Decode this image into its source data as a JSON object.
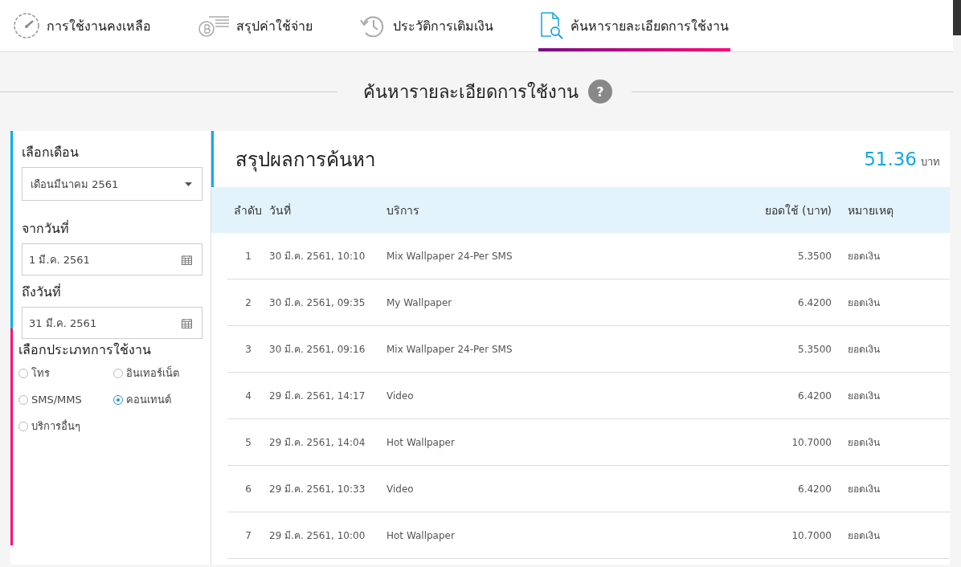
{
  "tabs": [
    {
      "label": "การใช้งานคงเหลือ",
      "kind": "gauge",
      "selected": false
    },
    {
      "label": "สรุปค่าใช้จ่าย",
      "kind": "coin",
      "selected": false
    },
    {
      "label": "ประวัติการเติมเงิน",
      "kind": "history",
      "selected": false
    },
    {
      "label": "ค้นหารายละเอียดการใช้งาน",
      "kind": "search",
      "selected": true
    }
  ],
  "page_title": "ค้นหารายละเอียดการใช้งาน",
  "help_label": "?",
  "filters": {
    "month_label": "เลือกเดือน",
    "month_value": "เดือนมีนาคม 2561",
    "from_label": "จากวันที่",
    "from_value": "1 มี.ค. 2561",
    "to_label": "ถึงวันที่",
    "to_value": "31 มี.ค. 2561",
    "type_label": "เลือกประเภทการใช้งาน",
    "types": [
      {
        "label": "โทร",
        "selected": false
      },
      {
        "label": "อินเทอร์เน็ต",
        "selected": false
      },
      {
        "label": "SMS/MMS",
        "selected": false
      },
      {
        "label": "คอนเทนต์",
        "selected": true
      },
      {
        "label": "บริการอื่นๆ",
        "selected": false
      }
    ]
  },
  "results": {
    "title": "สรุปผลการค้นหา",
    "total": "51.36",
    "currency": "บาท",
    "columns": [
      "ลำดับ",
      "วันที่",
      "บริการ",
      "ยอดใช้ (บาท)",
      "หมายเหตุ"
    ],
    "rows": [
      [
        "1",
        "30 มี.ค. 2561, 10:10",
        "Mix Wallpaper 24-Per SMS",
        "5.3500",
        "ยอดเงิน"
      ],
      [
        "2",
        "30 มี.ค. 2561, 09:35",
        "My Wallpaper",
        "6.4200",
        "ยอดเงิน"
      ],
      [
        "3",
        "30 มี.ค. 2561, 09:16",
        "Mix Wallpaper 24-Per SMS",
        "5.3500",
        "ยอดเงิน"
      ],
      [
        "4",
        "29 มี.ค. 2561, 14:17",
        "Video",
        "6.4200",
        "ยอดเงิน"
      ],
      [
        "5",
        "29 มี.ค. 2561, 14:04",
        "Hot Wallpaper",
        "10.7000",
        "ยอดเงิน"
      ],
      [
        "6",
        "29 มี.ค. 2561, 10:33",
        "Video",
        "6.4200",
        "ยอดเงิน"
      ],
      [
        "7",
        "29 มี.ค. 2561, 10:00",
        "Hot Wallpaper",
        "10.7000",
        "ยอดเงิน"
      ]
    ]
  }
}
